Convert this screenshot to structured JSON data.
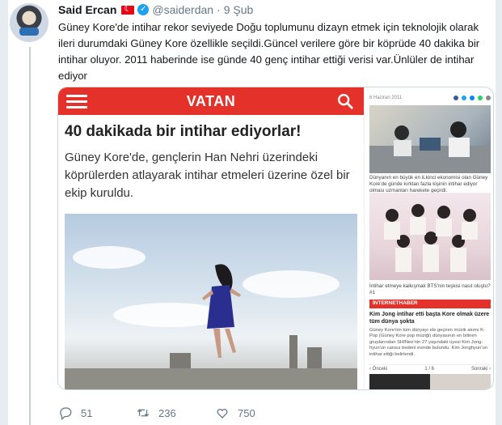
{
  "tweet": {
    "author_name": "Said Ercan",
    "handle": "@saiderdan",
    "separator": "·",
    "date": "9 Şub",
    "text": "Güney Kore'de intihar rekor seviyede Doğu toplumunu dizayn etmek için teknolojik olarak ileri durumdaki Güney Kore özellikle seçildi.Güncel verilere göre bir köprüde 40 dakika bir intihar oluyor. 2011 haberinde ise günde 40 genç intihar ettiği verisi var.Ünlüler de intihar ediyor"
  },
  "card": {
    "logo": "VATAN",
    "headline": "40 dakikada bir intihar ediyorlar!",
    "lead": "Güney Kore'de, gençlerin Han Nehri üzerindeki köprülerden atlayarak intihar etmeleri üzerine özel bir ekip kuruldu.",
    "sidebar": {
      "date": "6 Haziran 2011",
      "caption1": "Dünyanın en büyük en iLkinci ekonomisi olan Güney Kore'de günde kırktan fazla kişinin intihar ediyor olması uzmanları harekete geçirdi.",
      "caption2": "İntihar etmeye kalkışmak BTS'nin teşkisi nasıl oluştu? #1",
      "kicker": "İNTERNETHABER",
      "title": "Kim Jong intihar etti başta Kore olmak üzere tüm dünya şokta",
      "body": "Güney Kore'nin tüm dünyayı ele geçiren müzik akımı K-Pop (Güney Kore pop müziği) dünyasının en bilinen gruplarından SHINee'nin 27 yaşındaki üyesi Kim Jong-hyun'un cansız bedeni evinde bulundu. Kim Jonghyun'un intihar ettiği belirlendi.",
      "pager_prev": "‹ Önceki",
      "pager_count": "1 / 6",
      "pager_next": "Sonraki ›"
    }
  },
  "actions": {
    "reply_count": "51",
    "retweet_count": "236",
    "like_count": "750"
  },
  "colors": {
    "vatan_red": "#e4322b",
    "twitter_blue": "#1da1f2",
    "muted": "#657786"
  }
}
